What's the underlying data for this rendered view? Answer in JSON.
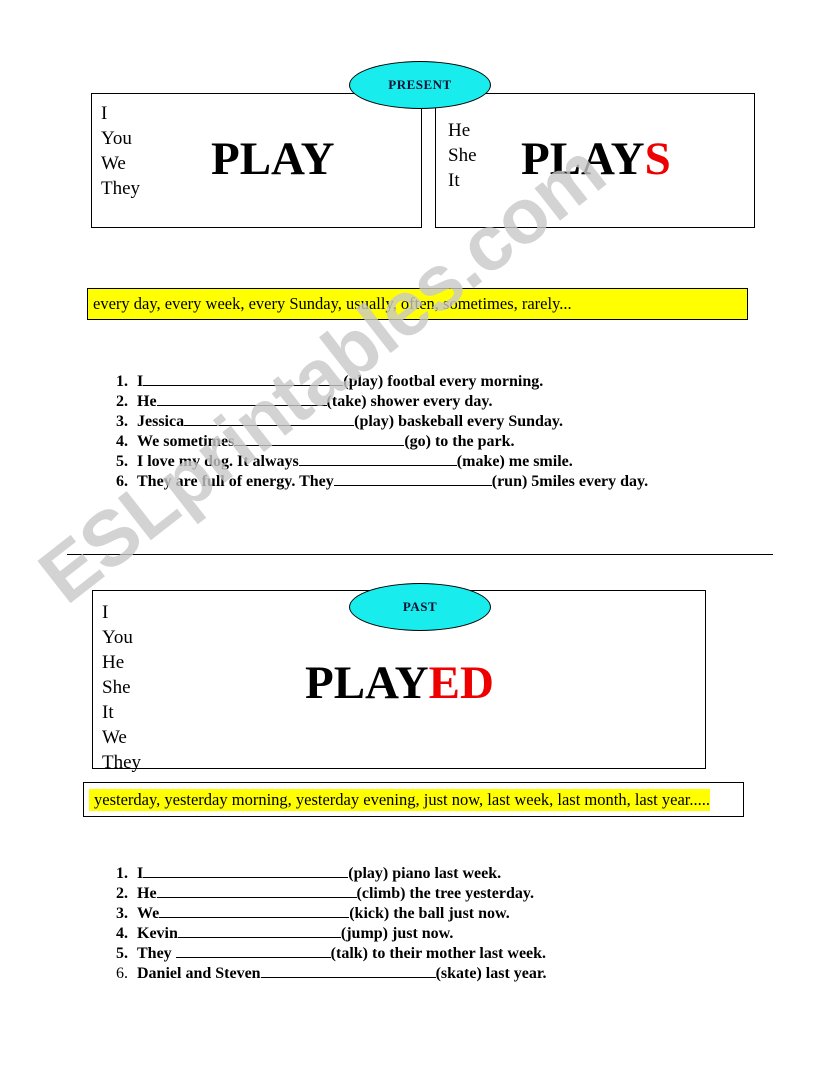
{
  "watermark": {
    "text": "ESLprintables.com"
  },
  "colors": {
    "ellipse_fill": "#18ecec",
    "highlight": "#ffff00",
    "suffix_red": "#ee0000",
    "ink": "#000000"
  },
  "present": {
    "ellipse_label": "PRESENT",
    "left_box": {
      "pronouns": [
        "I",
        "You",
        "We",
        "They"
      ],
      "verb_stem": "PLAY",
      "verb_suffix": ""
    },
    "right_box": {
      "pronouns": [
        "He",
        "She",
        "It"
      ],
      "verb_stem": "PLAY",
      "verb_suffix": "S"
    },
    "time_expressions": "every day, every week, every Sunday, usually, often, sometimes, rarely...",
    "exercises": [
      {
        "number": "1.",
        "before": "I",
        "blank_width": 200,
        "after": "(play) footbal every morning."
      },
      {
        "number": "2.",
        "before": "He",
        "blank_width": 170,
        "after": "(take) shower every day."
      },
      {
        "number": "3.",
        "before": "Jessica",
        "blank_width": 170,
        "after": "(play) baskeball every Sunday."
      },
      {
        "number": "4.",
        "before": "We sometimes",
        "blank_width": 170,
        "after": "(go) to the park."
      },
      {
        "number": "5.",
        "before": "I love my dog. It always",
        "blank_width": 158,
        "after": "(make) me smile."
      },
      {
        "number": "6.",
        "before": "They are full of energy. They",
        "blank_width": 158,
        "after": "(run) 5miles every day."
      }
    ]
  },
  "past": {
    "ellipse_label": "PAST",
    "box": {
      "pronouns": [
        "I",
        "You",
        "He",
        "She",
        "It",
        "We",
        "They"
      ],
      "verb_stem": "PLAY",
      "verb_suffix": "ED"
    },
    "time_expressions": "yesterday, yesterday morning, yesterday evening, just now, last week, last month, last year.....",
    "exercises": [
      {
        "number": "1.",
        "before": "I",
        "blank_width": 205,
        "after": "(play) piano last week."
      },
      {
        "number": "2.",
        "before": "He",
        "blank_width": 200,
        "after": "(climb) the tree yesterday."
      },
      {
        "number": "3.",
        "before": "We",
        "blank_width": 190,
        "after": "(kick) the ball just now."
      },
      {
        "number": "4.",
        "before": "Kevin",
        "blank_width": 163,
        "after": "(jump) just now."
      },
      {
        "number": "5.",
        "before": "They ",
        "blank_width": 155,
        "after": "(talk) to their mother last week."
      },
      {
        "number": "6.",
        "before": "Daniel and Steven",
        "blank_width": 175,
        "after": "(skate) last year."
      }
    ]
  }
}
